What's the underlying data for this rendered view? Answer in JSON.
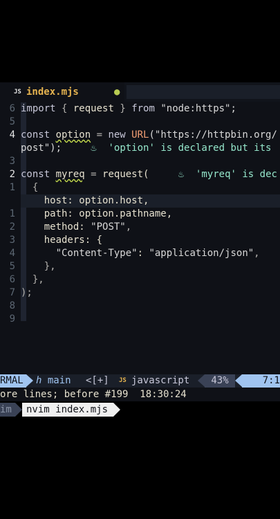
{
  "tab": {
    "icon": "JS",
    "filename": "index.mjs",
    "modified_dot": "●"
  },
  "lines": [
    {
      "num": "6",
      "current": false,
      "segments": [
        [
          "kw",
          "import"
        ],
        [
          "punct",
          " { "
        ],
        [
          "fn",
          "request"
        ],
        [
          "punct",
          " } "
        ],
        [
          "kw",
          "from"
        ],
        [
          "str",
          " \"node:https\";"
        ]
      ]
    },
    {
      "num": "5",
      "current": false,
      "segments": []
    },
    {
      "num": "4",
      "current": false,
      "segments": [
        [
          "kw",
          "const "
        ],
        [
          "squiggle",
          "option"
        ],
        [
          "punct",
          " = "
        ],
        [
          "kw",
          "new "
        ],
        [
          "url-fn",
          "URL"
        ],
        [
          "str",
          "(\"https://httpbin.org/"
        ]
      ]
    },
    {
      "num": "",
      "current": false,
      "segments": [
        [
          "str",
          "post\");"
        ],
        [
          "punct",
          "     "
        ],
        [
          "diag-icon",
          "♨"
        ],
        [
          "diag",
          "  'option' is declared but its"
        ]
      ]
    },
    {
      "num": "3",
      "current": false,
      "segments": []
    },
    {
      "num": "2",
      "current": false,
      "segments": [
        [
          "kw",
          "const "
        ],
        [
          "squiggle",
          "myreq"
        ],
        [
          "punct",
          " = "
        ],
        [
          "fn",
          "request("
        ],
        [
          "punct",
          "     "
        ],
        [
          "diag-icon",
          "♨"
        ],
        [
          "diag",
          "  'myreq' is dec"
        ]
      ]
    },
    {
      "num": "1",
      "current": false,
      "segments": [
        [
          "punct",
          "  {"
        ]
      ]
    },
    {
      "num": "",
      "current": true,
      "segments": [
        [
          "punct",
          "    "
        ],
        [
          "fn",
          "host: option.host,"
        ]
      ]
    },
    {
      "num": "1",
      "current": false,
      "segments": [
        [
          "punct",
          "    "
        ],
        [
          "fn",
          "path: option.pathname,"
        ]
      ]
    },
    {
      "num": "2",
      "current": false,
      "segments": [
        [
          "punct",
          "    "
        ],
        [
          "fn",
          "method: "
        ],
        [
          "str",
          "\"POST\""
        ],
        [
          "punct",
          ","
        ]
      ]
    },
    {
      "num": "3",
      "current": false,
      "segments": [
        [
          "punct",
          "    "
        ],
        [
          "fn",
          "headers: {"
        ]
      ]
    },
    {
      "num": "4",
      "current": false,
      "segments": [
        [
          "punct",
          "      "
        ],
        [
          "str",
          "\"Content-Type\""
        ],
        [
          "fn",
          ": "
        ],
        [
          "str",
          "\"application/json\""
        ],
        [
          "punct",
          ","
        ]
      ]
    },
    {
      "num": "5",
      "current": false,
      "segments": [
        [
          "punct",
          "    },"
        ]
      ]
    },
    {
      "num": "6",
      "current": false,
      "segments": [
        [
          "punct",
          "  },"
        ]
      ]
    },
    {
      "num": "7",
      "current": false,
      "segments": [
        [
          "punct",
          ");"
        ]
      ]
    },
    {
      "num": "8",
      "current": false,
      "segments": []
    },
    {
      "num": "9",
      "current": false,
      "segments": []
    }
  ],
  "status": {
    "mode": "RMAL",
    "branch": "ℎ main",
    "modified": "<[+]",
    "filetype_icon": "JS",
    "filetype": "javascript",
    "percent": "43%",
    "position": "7:1"
  },
  "message": "ore lines; before #199  18:30:24",
  "tmux": {
    "left": "im",
    "session": "nvim index.mjs"
  }
}
